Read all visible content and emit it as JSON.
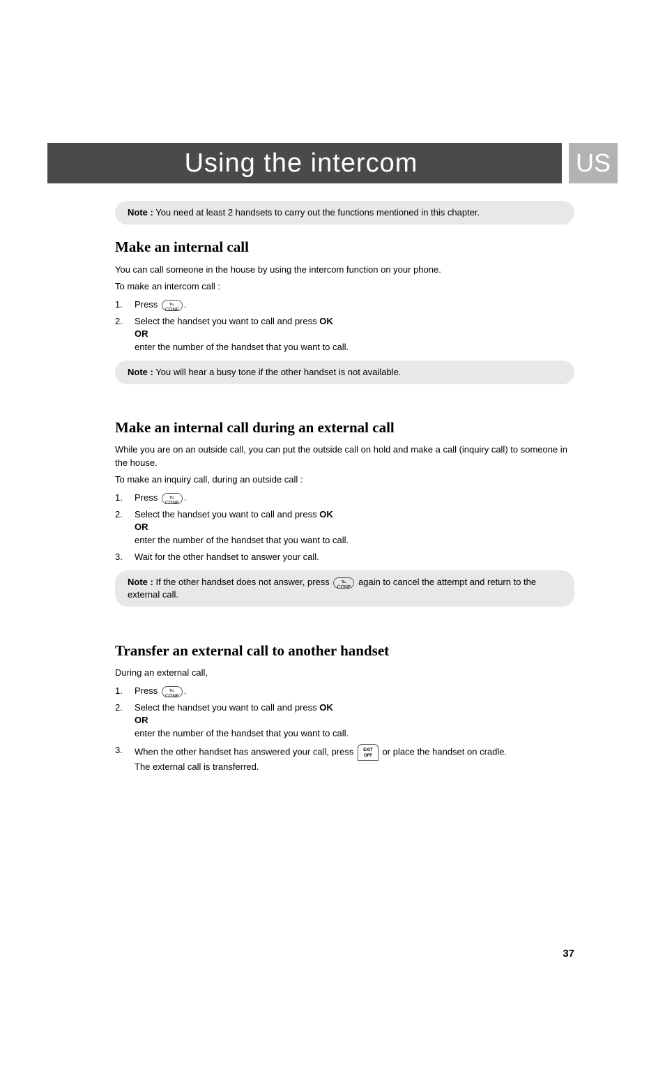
{
  "header": {
    "title": "Using the intercom",
    "badge": "US"
  },
  "notes": {
    "top": {
      "label": "Note :",
      "text": " You need at least 2 handsets to carry out the functions mentioned in this chapter."
    },
    "busy": {
      "label": "Note :",
      "text": " You will hear a busy tone if the other handset is not available."
    },
    "noAnswer": {
      "label": "Note :",
      "part1": " If the other handset does not answer, press ",
      "part2": " again to cancel the attempt and return to the external call."
    }
  },
  "sections": {
    "s1": {
      "title": "Make an internal call",
      "intro1": "You can call someone in the house by using the intercom function on your phone.",
      "intro2": "To make an intercom call :",
      "step1": "Press ",
      "step1end": ".",
      "step2a": "Select the handset you want to call and press ",
      "step2ok": "OK",
      "step2or": "OR",
      "step2b": "enter the number of the handset that you want to call."
    },
    "s2": {
      "title": "Make an internal call during an external call",
      "intro1": "While you are on an outside call, you can put the outside call on hold and make a call (inquiry call) to someone in the house.",
      "intro2": "To make an inquiry call, during an outside call :",
      "step1": "Press ",
      "step1end": ".",
      "step2a": "Select the handset you want to call and press ",
      "step2ok": "OK",
      "step2or": "OR",
      "step2b": "enter the number of the handset that you want to call.",
      "step3": "Wait for the other handset to answer your call."
    },
    "s3": {
      "title": "Transfer an external call to another handset",
      "intro1": "During an external call,",
      "step1": "Press ",
      "step1end": ".",
      "step2a": "Select the handset you want to call and press ",
      "step2ok": "OK",
      "step2or": "OR",
      "step2b": "enter the number of the handset that you want to call.",
      "step3a": "When the other handset has answered your call, press ",
      "step3b": " or place the handset on cradle.",
      "step3c": "The external call is transferred."
    }
  },
  "icons": {
    "conf": "℡\nCONF",
    "off": "EXIT\nOFF"
  },
  "pageNumber": "37"
}
